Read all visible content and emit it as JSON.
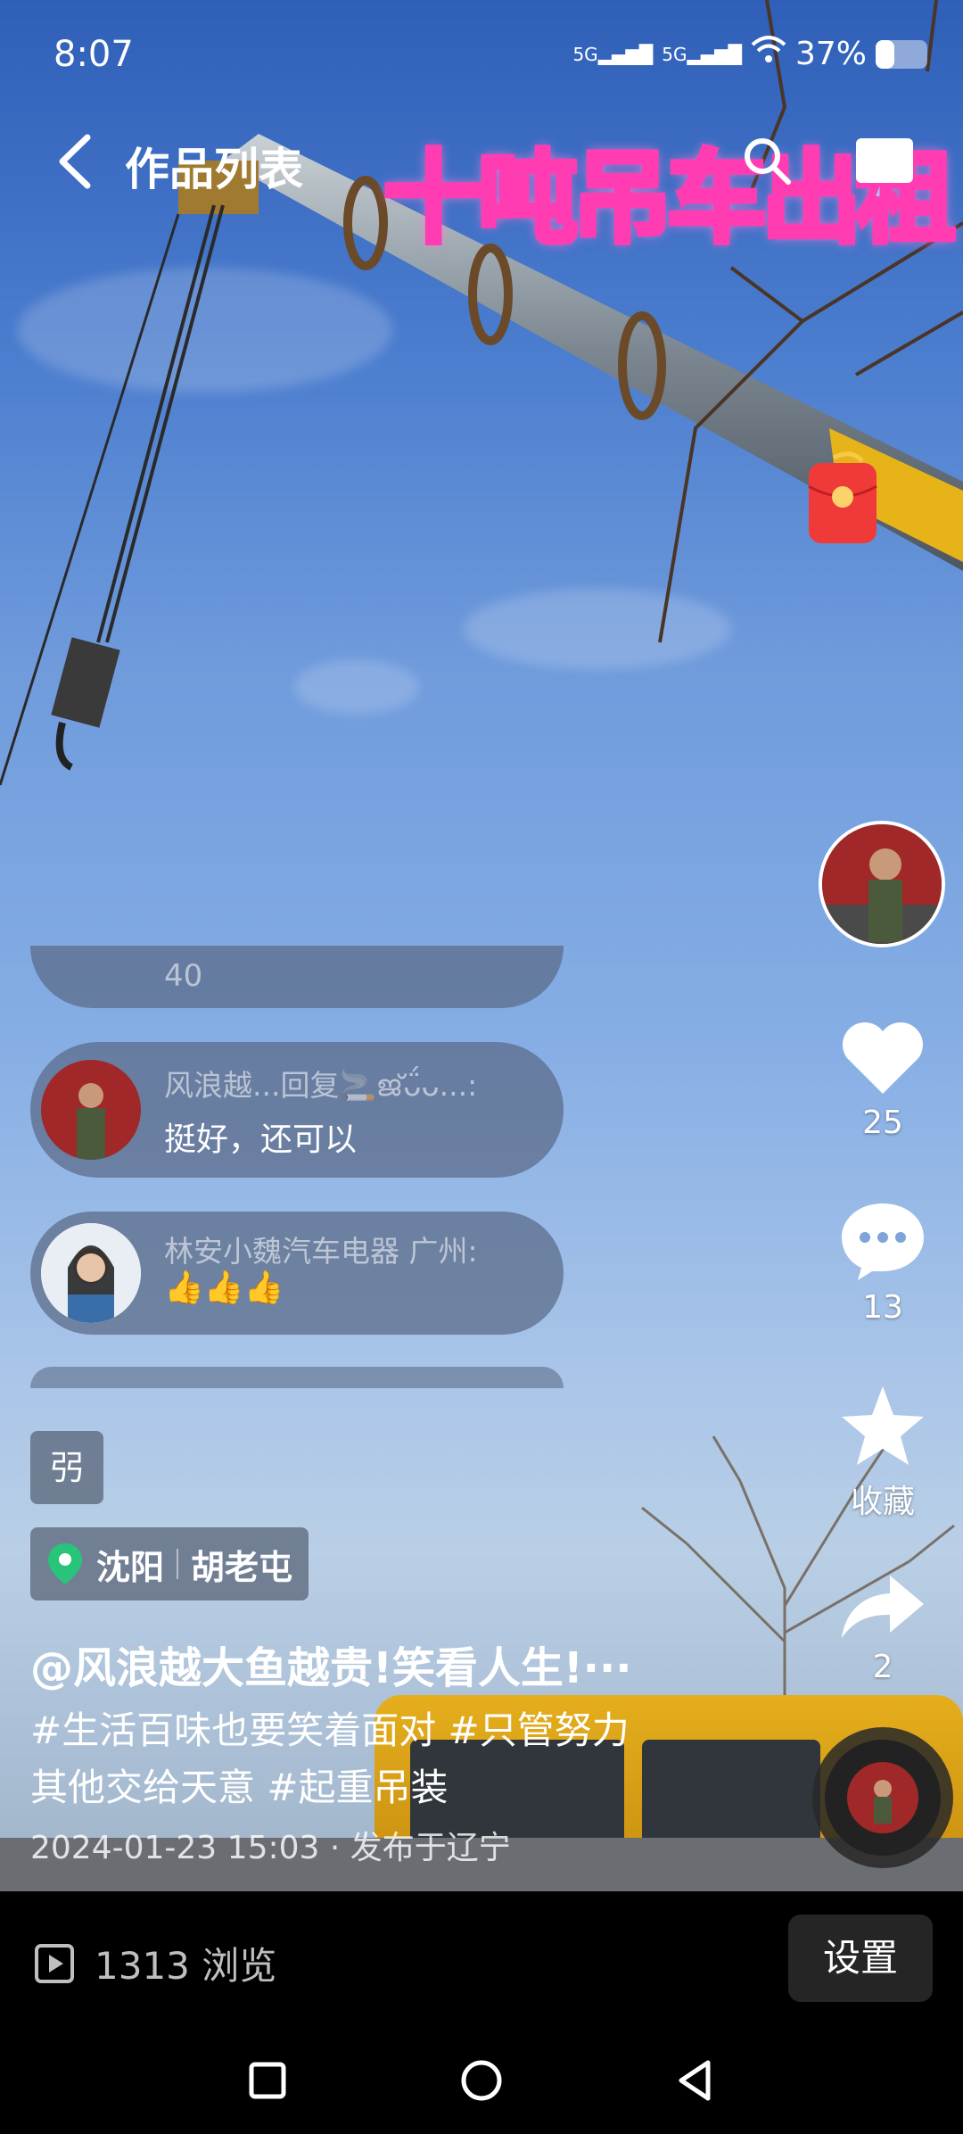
{
  "status_bar": {
    "time": "8:07",
    "signal_1": "5G",
    "signal_2": "5G",
    "battery_text": "37%",
    "battery_level": 0.37
  },
  "header": {
    "back_icon": "chevron-left-icon",
    "title": "作品列表",
    "search_icon": "search-icon",
    "more_icon": "more-icon"
  },
  "video": {
    "overlay_title": "十吨吊车出租"
  },
  "right_rail": {
    "like_count": "25",
    "comment_count": "13",
    "favorite_label": "收藏",
    "share_count": "2"
  },
  "comments": [
    {
      "name": "",
      "text": "40"
    },
    {
      "name": "风浪越...回复🚬ജ്ᴗ̈́ᴗ...:",
      "text": "挺好，还可以"
    },
    {
      "name": "林安小魏汽车电器 广州:",
      "text": "👍👍👍"
    }
  ],
  "post": {
    "tag_label": "弜",
    "location_city": "沈阳",
    "location_place": "胡老屯",
    "author_line": "@风浪越大鱼越贵!笑看人生!···",
    "description_line1": "#生活百味也要笑着面对 #只管努力",
    "description_line2": "其他交给天意 #起重吊装",
    "date_line": "2024-01-23 15:03 · 发布于辽宁"
  },
  "bottom_bar": {
    "views": "1313 浏览",
    "settings_label": "设置"
  },
  "colors": {
    "sky_top": "#2f5fb8",
    "overlay_stroke": "#ff3cb2",
    "location_pin": "#27c47a",
    "red_packet": "#f03a3a"
  }
}
